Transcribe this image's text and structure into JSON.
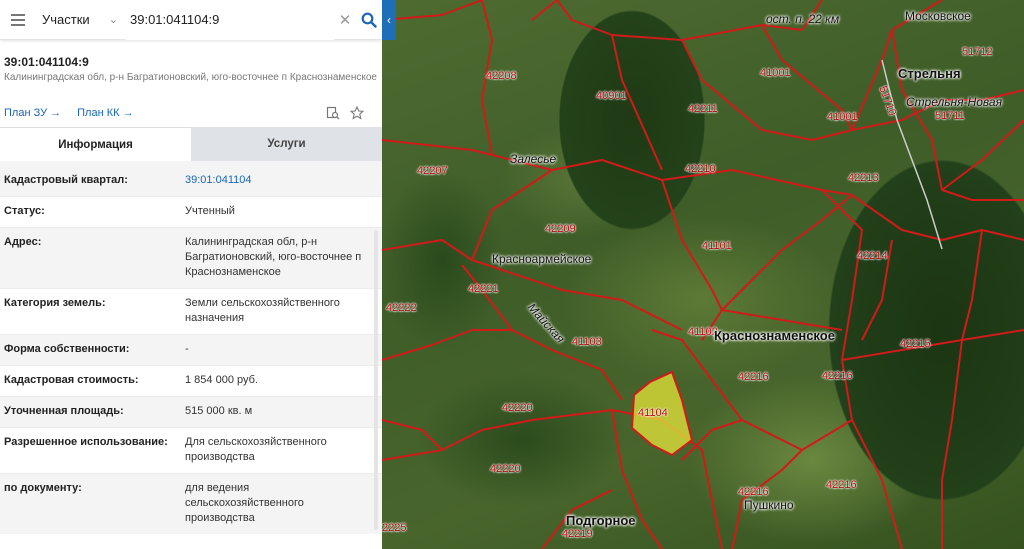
{
  "search": {
    "scope": "Участки",
    "value": "39:01:041104:9"
  },
  "object": {
    "title": "39:01:041104:9",
    "address_short": "Калининградская обл, р-н Багратионовский, юго-восточнее п Краснознаменское"
  },
  "links": {
    "plan_zu": "План ЗУ →",
    "plan_kk": "План КК →"
  },
  "tabs": [
    {
      "label": "Информация",
      "active": true
    },
    {
      "label": "Услуги",
      "active": false
    }
  ],
  "properties": [
    {
      "key": "Кадастровый квартал:",
      "value": "39:01:041104",
      "link": true
    },
    {
      "key": "Статус:",
      "value": "Учтенный"
    },
    {
      "key": "Адрес:",
      "value": "Калининградская обл, р-н Багратионовский, юго-восточнее п Краснознаменское"
    },
    {
      "key": "Категория земель:",
      "value": "Земли сельскохозяйственного назначения"
    },
    {
      "key": "Форма собственности:",
      "value": "-"
    },
    {
      "key": "Кадастровая стоимость:",
      "value": "1 854 000 руб."
    },
    {
      "key": "Уточненная площадь:",
      "value": "515 000 кв. м"
    },
    {
      "key": "Разрешенное использование:",
      "value": "Для сельскохозяйственного производства"
    },
    {
      "key": "по документу:",
      "value": "для ведения сельскохозяйственного производства"
    }
  ],
  "map": {
    "quarter_labels": [
      "42208",
      "40901",
      "41001",
      "42211",
      "41001",
      "51712",
      "51711",
      "42207",
      "42210",
      "42213",
      "42209",
      "41101",
      "42214",
      "42221",
      "42222",
      "41103",
      "41102",
      "42215",
      "42216",
      "42216",
      "42220",
      "41104",
      "42220",
      "42216",
      "42216",
      "42219",
      "2225"
    ],
    "places": [
      "Стрельня",
      "Стрельня-Новая",
      "Московское",
      "Залесье",
      "Красноармейское",
      "Краснознаменское",
      "Подгорное",
      "Пушкино",
      "ост. п. 22 км",
      "Майская",
      "51710"
    ],
    "highlighted_quarter": "41104",
    "colors": {
      "boundary": "#d11a1a",
      "highlight": "#e6e63a",
      "accent": "#1a66b8"
    }
  }
}
